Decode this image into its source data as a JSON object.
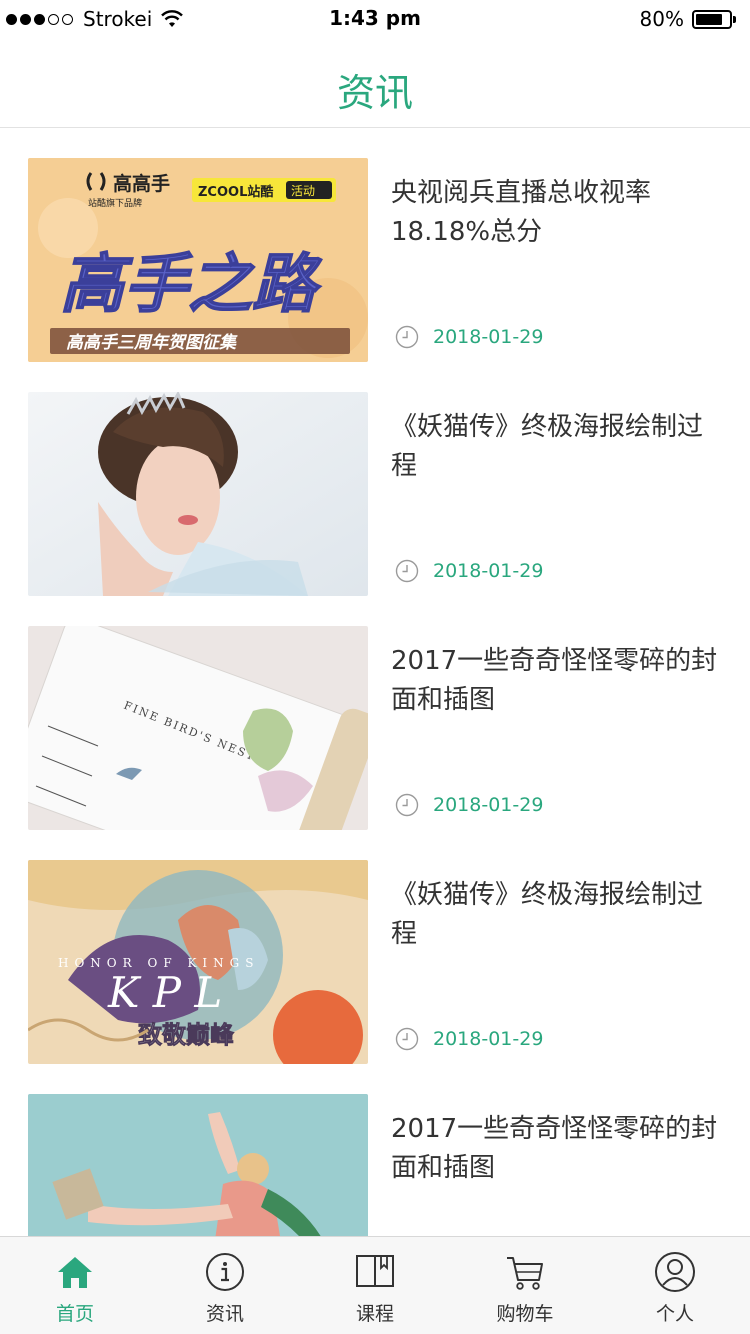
{
  "status_bar": {
    "carrier": "Strokei",
    "time": "1:43 pm",
    "battery_percent": "80%",
    "battery_level": 0.8
  },
  "nav": {
    "title": "资讯"
  },
  "news": [
    {
      "title": "央视阅兵直播总收视率18.18%总分",
      "date": "2018-01-29",
      "thumb": {
        "brand": "高高手",
        "brand_sub": "站酷旗下品牌",
        "partner": "ZCOOL站酷",
        "partner_badge": "活动",
        "headline": "高手之路",
        "footer": "高高手三周年贺图征集"
      }
    },
    {
      "title": "《妖猫传》终极海报绘制过程",
      "date": "2018-01-29",
      "thumb": {}
    },
    {
      "title": "2017一些奇奇怪怪零碎的封面和插图",
      "date": "2018-01-29",
      "thumb": {
        "label": "FINE BIRD'S NEST"
      }
    },
    {
      "title": "《妖猫传》终极海报绘制过程",
      "date": "2018-01-29",
      "thumb": {
        "arc_text": "HONOR OF KINGS",
        "letters": "K  P  L",
        "headline": "致敬巅峰"
      }
    },
    {
      "title": "2017一些奇奇怪怪零碎的封面和插图",
      "date": "",
      "thumb": {}
    }
  ],
  "tabs": [
    {
      "label": "首页",
      "icon": "home-icon",
      "active": true
    },
    {
      "label": "资讯",
      "icon": "info-icon",
      "active": false
    },
    {
      "label": "课程",
      "icon": "book-icon",
      "active": false
    },
    {
      "label": "购物车",
      "icon": "cart-icon",
      "active": false
    },
    {
      "label": "个人",
      "icon": "person-icon",
      "active": false
    }
  ],
  "colors": {
    "accent": "#2aa77e",
    "text": "#333333",
    "tab_bg": "#f7f7f7"
  }
}
